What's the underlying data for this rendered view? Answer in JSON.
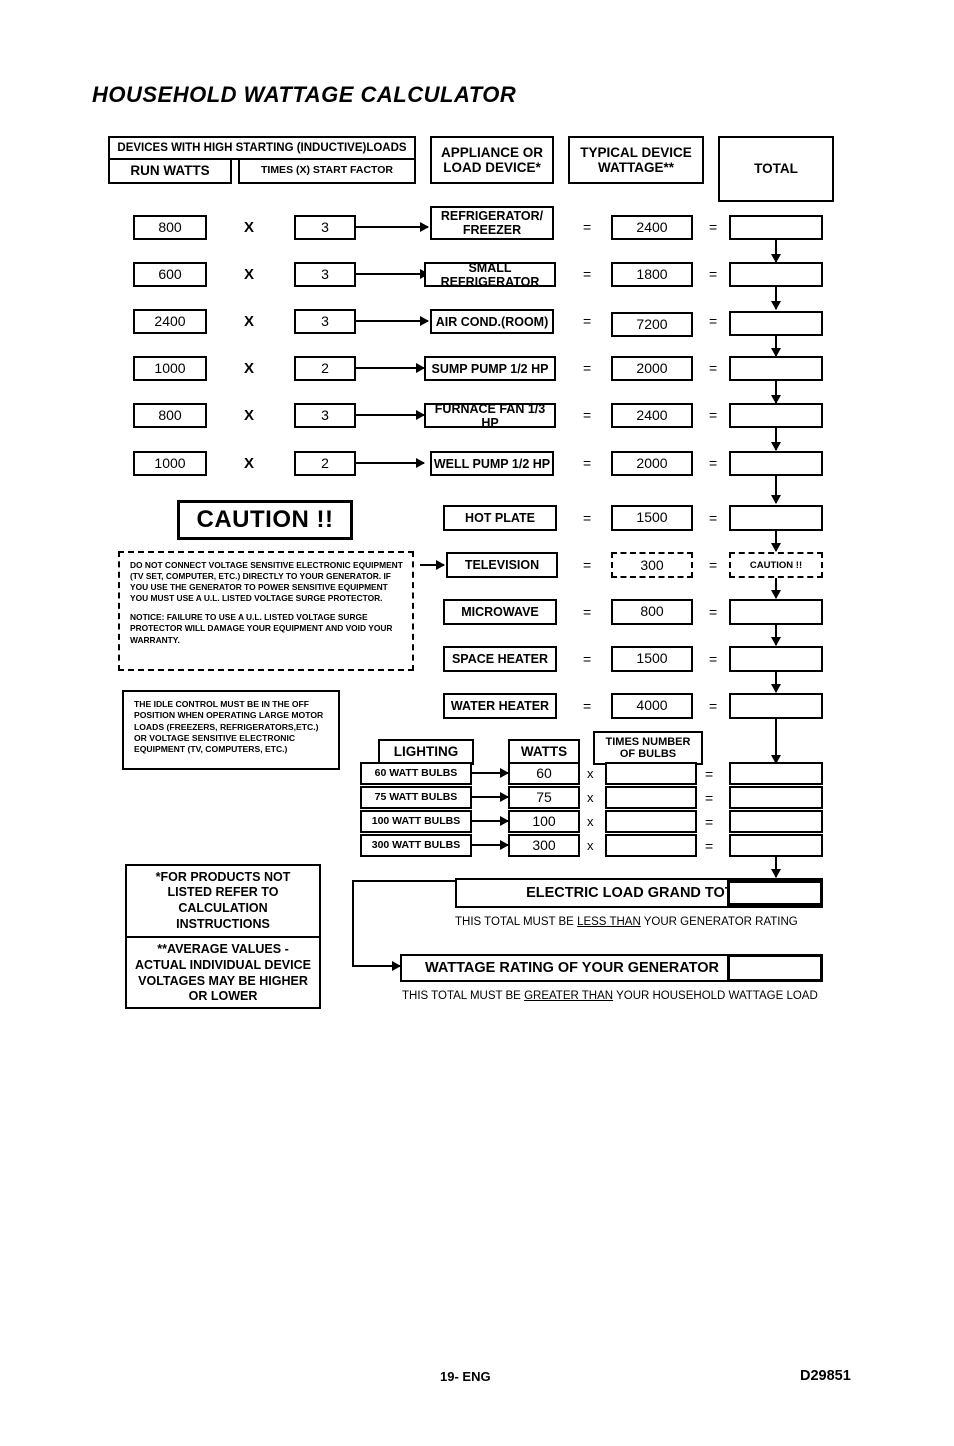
{
  "title": "HOUSEHOLD WATTAGE CALCULATOR",
  "headers": {
    "high_start": "DEVICES WITH HIGH STARTING (INDUCTIVE)LOADS",
    "run_watts": "RUN WATTS",
    "start_factor": "TIMES (X) START FACTOR",
    "appliance": "APPLIANCE OR\nLOAD DEVICE*",
    "appliance_line1": "APPLIANCE OR",
    "appliance_line2": "LOAD DEVICE*",
    "typical_line1": "TYPICAL DEVICE",
    "typical_line2": "WATTAGE**",
    "total": "TOTAL"
  },
  "symbols": {
    "times": "X",
    "times_lower": "x",
    "equals": "="
  },
  "inductive_rows": [
    {
      "run_watts": "800",
      "factor": "3",
      "device_line1": "REFRIGERATOR/",
      "device_line2": "FREEZER",
      "wattage": "2400",
      "total": ""
    },
    {
      "run_watts": "600",
      "factor": "3",
      "device_line1": "SMALL REFRIGERATOR",
      "device_line2": "",
      "wattage": "1800",
      "total": ""
    },
    {
      "run_watts": "2400",
      "factor": "3",
      "device_line1": "AIR COND.(ROOM)",
      "device_line2": "",
      "wattage": "7200",
      "total": ""
    },
    {
      "run_watts": "1000",
      "factor": "2",
      "device_line1": "SUMP PUMP 1/2 HP",
      "device_line2": "",
      "wattage": "2000",
      "total": ""
    },
    {
      "run_watts": "800",
      "factor": "3",
      "device_line1": "FURNACE FAN 1/3 HP",
      "device_line2": "",
      "wattage": "2400",
      "total": ""
    },
    {
      "run_watts": "1000",
      "factor": "2",
      "device_line1": "WELL PUMP 1/2 HP",
      "device_line2": "",
      "wattage": "2000",
      "total": ""
    }
  ],
  "resistive_rows": [
    {
      "device": "HOT PLATE",
      "wattage": "1500",
      "total": ""
    },
    {
      "device": "TELEVISION",
      "wattage": "300",
      "total": "CAUTION !!"
    },
    {
      "device": "MICROWAVE",
      "wattage": "800",
      "total": ""
    },
    {
      "device": "SPACE HEATER",
      "wattage": "1500",
      "total": ""
    },
    {
      "device": "WATER HEATER",
      "wattage": "4000",
      "total": ""
    }
  ],
  "caution": {
    "banner": "CAUTION !!",
    "notice_para1": "DO NOT CONNECT VOLTAGE SENSITIVE ELECTRONIC EQUIPMENT (TV SET, COMPUTER, ETC.) DIRECTLY TO YOUR GENERATOR. IF YOU USE THE GENERATOR TO POWER SENSITIVE EQUIPMENT YOU MUST USE A U.L. LISTED VOLTAGE SURGE PROTECTOR.",
    "notice_para2": "NOTICE:  FAILURE TO USE A U.L. LISTED VOLTAGE SURGE PROTECTOR WILL DAMAGE YOUR EQUIPMENT AND VOID YOUR WARRANTY."
  },
  "idle_note": "THE IDLE CONTROL MUST BE IN THE OFF POSITION WHEN OPERATING LARGE MOTOR LOADS (FREEZERS, REFRIGERATORS,ETC.) OR VOLTAGE SENSITIVE ELECTRONIC EQUIPMENT (TV, COMPUTERS, ETC.)",
  "lighting": {
    "header_lighting": "LIGHTING",
    "header_watts": "WATTS",
    "header_bulbs_line1": "TIMES NUMBER",
    "header_bulbs_line2": "OF BULBS",
    "rows": [
      {
        "label": "60 WATT BULBS",
        "watts": "60",
        "bulbs": "",
        "total": ""
      },
      {
        "label": "75 WATT BULBS",
        "watts": "75",
        "bulbs": "",
        "total": ""
      },
      {
        "label": "100 WATT BULBS",
        "watts": "100",
        "bulbs": "",
        "total": ""
      },
      {
        "label": "300 WATT BULBS",
        "watts": "300",
        "bulbs": "",
        "total": ""
      }
    ]
  },
  "footnotes": {
    "top": "*FOR PRODUCTS NOT LISTED REFER TO CALCULATION INSTRUCTIONS",
    "bottom": "**AVERAGE VALUES - ACTUAL INDIVIDUAL DEVICE VOLTAGES MAY BE HIGHER OR LOWER"
  },
  "grand_total": {
    "label": "ELECTRIC LOAD GRAND TOTAL",
    "value": "",
    "note_pre": "THIS TOTAL MUST BE ",
    "note_em": "LESS THAN",
    "note_post": " YOUR GENERATOR RATING"
  },
  "generator_rating": {
    "label": "WATTAGE RATING OF YOUR GENERATOR",
    "value": "",
    "note_pre": "THIS TOTAL MUST BE ",
    "note_em": "GREATER THAN",
    "note_post": " YOUR HOUSEHOLD WATTAGE LOAD"
  },
  "footer": {
    "page": "19- ENG",
    "code": "D29851"
  }
}
